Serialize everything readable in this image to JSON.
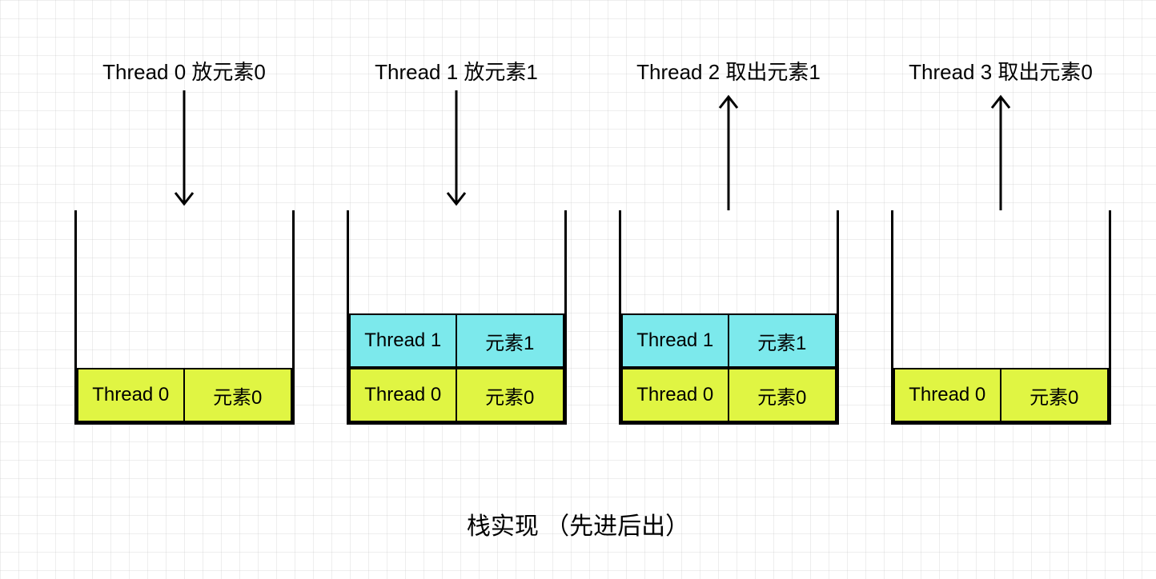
{
  "titles": {
    "step1": "Thread 0 放元素0",
    "step2": "Thread 1 放元素1",
    "step3": "Thread 2 取出元素1",
    "step4": "Thread 3 取出元素0"
  },
  "rows": {
    "t0": "Thread 0",
    "e0": "元素0",
    "t1": "Thread 1",
    "e1": "元素1"
  },
  "footer": "栈实现 （先进后出）",
  "chart_data": {
    "type": "table",
    "title": "栈实现 （先进后出）",
    "description": "Stack (LIFO) illustration with 4 thread actions",
    "steps": [
      {
        "action": "push",
        "actor": "Thread 0",
        "item": "元素0",
        "label": "Thread 0 放元素0",
        "arrow_direction": "down",
        "stack_after": [
          {
            "thread": "Thread 0",
            "element": "元素0"
          }
        ]
      },
      {
        "action": "push",
        "actor": "Thread 1",
        "item": "元素1",
        "label": "Thread 1 放元素1",
        "arrow_direction": "down",
        "stack_after": [
          {
            "thread": "Thread 0",
            "element": "元素0"
          },
          {
            "thread": "Thread 1",
            "element": "元素1"
          }
        ]
      },
      {
        "action": "pop",
        "actor": "Thread 2",
        "item": "元素1",
        "label": "Thread 2 取出元素1",
        "arrow_direction": "up",
        "stack_before": [
          {
            "thread": "Thread 0",
            "element": "元素0"
          },
          {
            "thread": "Thread 1",
            "element": "元素1"
          }
        ]
      },
      {
        "action": "pop",
        "actor": "Thread 3",
        "item": "元素0",
        "label": "Thread 3 取出元素0",
        "arrow_direction": "up",
        "stack_before": [
          {
            "thread": "Thread 0",
            "element": "元素0"
          }
        ]
      }
    ],
    "colors": {
      "row_thread0": "#e0f543",
      "row_thread1": "#7ce9ec"
    }
  }
}
